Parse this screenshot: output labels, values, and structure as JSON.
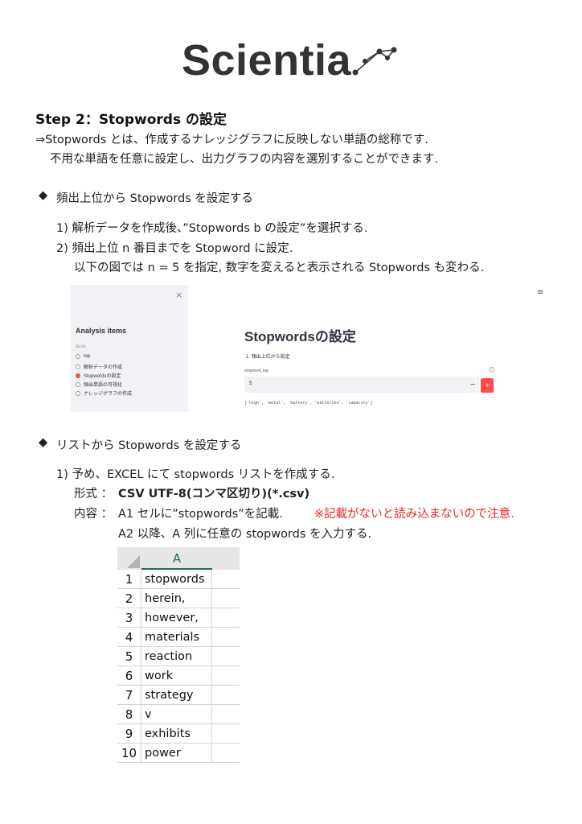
{
  "logo": {
    "text": "Scientia",
    "icon": "constellation-icon"
  },
  "heading": "Step 2：Stopwords の設定",
  "intro": [
    "⇒Stopwords とは、作成するナレッジグラフに反映しない単語の総称です.",
    "不用な単語を任意に設定し、出力グラフの内容を選別することができます."
  ],
  "section1": {
    "bullet": "◆",
    "title": "頻出上位から Stopwords を設定する",
    "steps": [
      "1) 解析データを作成後、”Stopwords b の設定”を選択する.",
      "2) 頻出上位 n 番目までを Stopword に設定.",
      "以下の図では n = 5 を指定, 数字を変えると表示される Stopwords も変わる."
    ]
  },
  "app": {
    "close": "×",
    "sidebar_title": "Analysis items",
    "goto_label": "Go to",
    "radio_items": [
      {
        "label": "top",
        "selected": false
      },
      {
        "label": "解析データの作成",
        "selected": false
      },
      {
        "label": "Stopwordsの設定",
        "selected": true
      },
      {
        "label": "頻出単語の可視化",
        "selected": false
      },
      {
        "label": "ナレッジグラフの作成",
        "selected": false
      }
    ],
    "menu": "≡",
    "page_title": "Stopwordsの設定",
    "subheading": "1.  頻出上位から設定",
    "input_label": "stopword_top",
    "help": "?",
    "input_value": "5",
    "minus": "−",
    "plus": "+",
    "output": "['high', 'metal', 'battery', 'batteries', 'capacity']",
    "accent": "#ff4b4b"
  },
  "section2": {
    "bullet": "◆",
    "title": "リストから Stopwords を設定する",
    "step1": "1) 予め、EXCEL にて stopwords リストを作成する.",
    "format_label": "形式 ：",
    "format_value": "CSV UTF-8(コンマ区切り)(*.csv)",
    "content_label": "内容 ：",
    "content_line1": "A1 セルに”stopwords”を記載.",
    "content_warning": "※記載がないと読み込まないので注意.",
    "content_line2": "A2 以降、A 列に任意の stopwords を入力する."
  },
  "excel": {
    "column": "A",
    "header_color": "#217346",
    "rows": [
      {
        "n": "1",
        "v": "stopwords"
      },
      {
        "n": "2",
        "v": "herein,"
      },
      {
        "n": "3",
        "v": "however,"
      },
      {
        "n": "4",
        "v": "materials"
      },
      {
        "n": "5",
        "v": "reaction"
      },
      {
        "n": "6",
        "v": "work"
      },
      {
        "n": "7",
        "v": "strategy"
      },
      {
        "n": "8",
        "v": "v"
      },
      {
        "n": "9",
        "v": "exhibits"
      },
      {
        "n": "10",
        "v": "power"
      }
    ]
  }
}
